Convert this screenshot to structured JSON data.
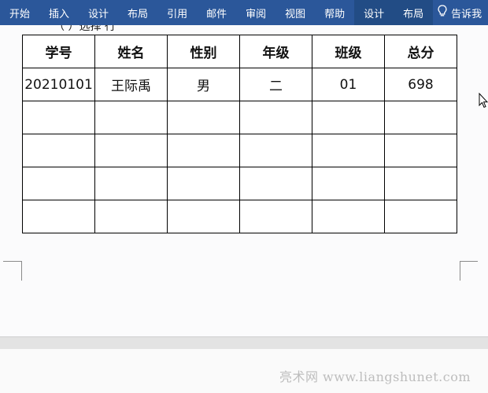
{
  "ribbon": {
    "tabs": [
      "开始",
      "插入",
      "设计",
      "布局",
      "引用",
      "邮件",
      "审阅",
      "视图",
      "帮助"
    ],
    "context_tabs": [
      "设计",
      "布局"
    ],
    "tell_me": "告诉我",
    "icons": {
      "tell_me": "lightbulb-icon"
    },
    "colors": {
      "bar": "#2b579a",
      "context": "#224c85",
      "text": "#ffffff"
    }
  },
  "document": {
    "partial_text": "（   ）选择 行",
    "table": {
      "headers": [
        "学号",
        "姓名",
        "性别",
        "年级",
        "班级",
        "总分"
      ],
      "rows": [
        [
          "20210101",
          "王际禹",
          "男",
          "二",
          "01",
          "698"
        ],
        [
          "",
          "",
          "",
          "",
          "",
          ""
        ],
        [
          "",
          "",
          "",
          "",
          "",
          ""
        ],
        [
          "",
          "",
          "",
          "",
          "",
          ""
        ],
        [
          "",
          "",
          "",
          "",
          "",
          ""
        ]
      ]
    }
  },
  "watermark": "亮术网 www.liangshunet.com",
  "cursor_icon": "mouse-pointer-icon"
}
